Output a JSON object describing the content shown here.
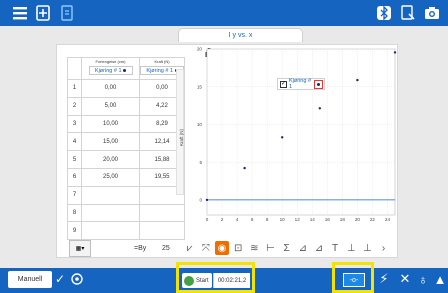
{
  "graph_tab": {
    "title": "I y vs. x"
  },
  "table": {
    "col1_header": "Forlengelse (cm)",
    "col2_header": "Kraft (N)",
    "run_label": "Kjøring # 1",
    "rows": [
      {
        "idx": "1",
        "x": "0,00",
        "y": "0,00"
      },
      {
        "idx": "2",
        "x": "5,00",
        "y": "4,22"
      },
      {
        "idx": "3",
        "x": "10,00",
        "y": "8,29"
      },
      {
        "idx": "4",
        "x": "15,00",
        "y": "12,14"
      },
      {
        "idx": "5",
        "x": "20,00",
        "y": "15,88"
      },
      {
        "idx": "6",
        "x": "25,00",
        "y": "19,55"
      },
      {
        "idx": "7",
        "x": "",
        "y": ""
      },
      {
        "idx": "8",
        "x": "",
        "y": ""
      },
      {
        "idx": "9",
        "x": "",
        "y": ""
      }
    ]
  },
  "graph": {
    "ylabel": "Kraft (N)",
    "legend_label": "Kjøring # 1",
    "legend_checkmark": "✓"
  },
  "chart_data": {
    "type": "scatter",
    "xlim": [
      0,
      25
    ],
    "ylim": [
      -2,
      20
    ],
    "x_ticks": [
      "0",
      "2",
      "4",
      "6",
      "8",
      "10",
      "12",
      "14",
      "16",
      "18",
      "20",
      "22",
      "24"
    ],
    "y_ticks": [
      "0",
      "5",
      "10",
      "15",
      "20"
    ],
    "grid": true,
    "series": [
      {
        "name": "Kjøring # 1",
        "x": [
          0,
          5,
          10,
          15,
          20,
          25
        ],
        "y": [
          0,
          4.22,
          8.29,
          12.14,
          15.88,
          19.55
        ]
      }
    ],
    "colors": {
      "points": "#1a237e"
    }
  },
  "toolbar": {
    "formula_label": "=By",
    "formula_suffix": "25",
    "table_menu_icon": "▦▾",
    "tools": [
      "⩗",
      "⤧",
      "◉",
      "⊡",
      "≋",
      "⊢",
      "Σ",
      "⊿",
      "⊿",
      "T",
      "⊥",
      "⊥",
      "›"
    ]
  },
  "bottom": {
    "mode_label": "Manuell",
    "start_label": "Start",
    "timer": "00:02:21,2",
    "keep_label": "-o-"
  },
  "colors": {
    "header": "#1565c0",
    "highlight": "#f4e300",
    "start": "#43a047"
  }
}
